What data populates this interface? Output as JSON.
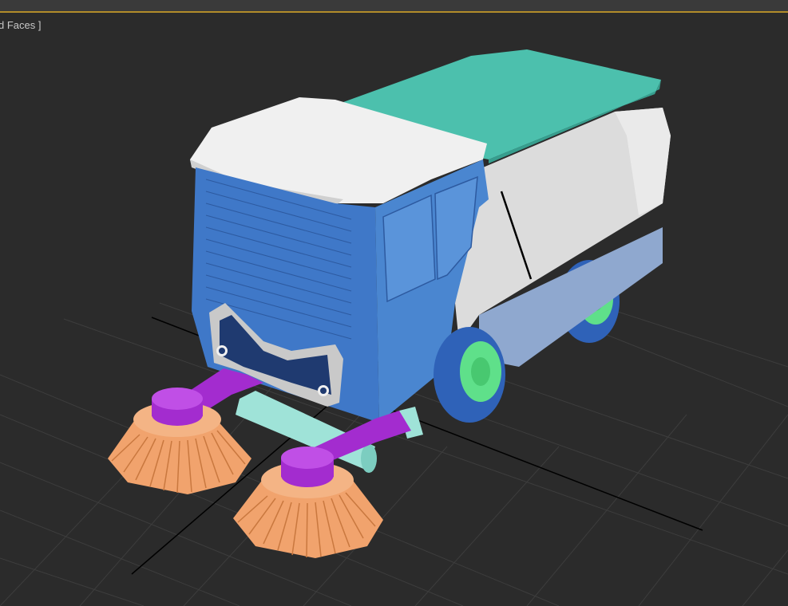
{
  "viewport": {
    "shading_label": "d Faces ]",
    "active_border_color": "#b28c2a",
    "background_color": "#2b2b2b",
    "grid_color": "#3d3d3d",
    "axis_color": "#000000"
  },
  "scene": {
    "model_colors": {
      "cab": "#3f78c8",
      "roof": "#f0f0f0",
      "hopper_top": "#4cc0ad",
      "body_side": "#dcdcdc",
      "body_lower": "#8fa8cf",
      "wheel_tire": "#2f62b8",
      "wheel_hub": "#5fe08a",
      "brush_arm": "#a32ccf",
      "brush_bristles": "#f1a36d",
      "roller": "#9fe3d8"
    }
  }
}
